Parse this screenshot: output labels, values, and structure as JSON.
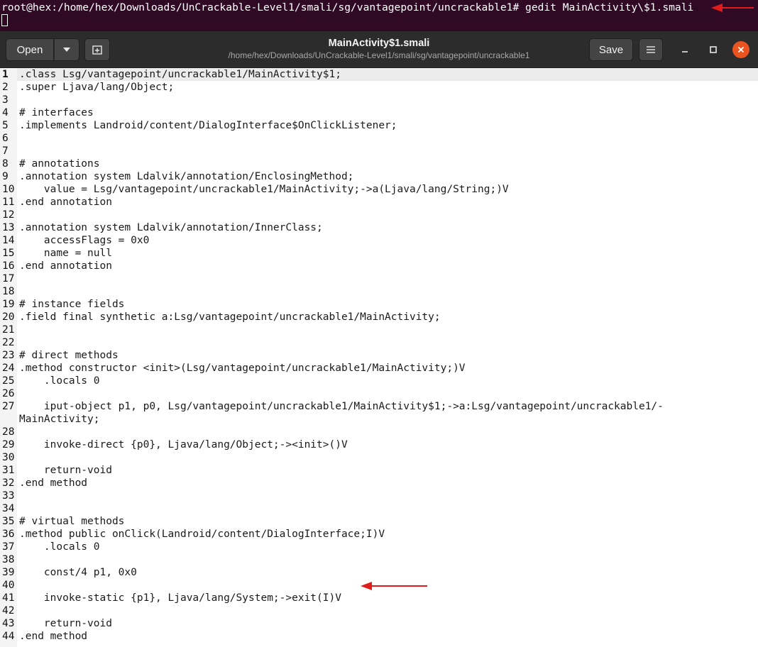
{
  "terminal": {
    "command": "root@hex:/home/hex/Downloads/UnCrackable-Level1/smali/sg/vantagepoint/uncrackable1# gedit MainActivity\\$1.smali"
  },
  "headerbar": {
    "open_label": "Open",
    "save_label": "Save",
    "title": "MainActivity$1.smali",
    "subtitle": "/home/hex/Downloads/UnCrackable-Level1/smali/sg/vantagepoint/uncrackable1"
  },
  "icons": {
    "open_menu": "chevron-down-icon",
    "new_tab": "new-tab-icon",
    "menu": "hamburger-menu-icon",
    "minimize": "minimize-icon",
    "maximize": "maximize-icon",
    "close": "close-icon",
    "annotation_arrow_color": "#e01b1b"
  },
  "editor": {
    "lines": [
      {
        "n": "1",
        "text": ".class Lsg/vantagepoint/uncrackable1/MainActivity$1;"
      },
      {
        "n": "2",
        "text": ".super Ljava/lang/Object;"
      },
      {
        "n": "3",
        "text": ""
      },
      {
        "n": "4",
        "text": "# interfaces"
      },
      {
        "n": "5",
        "text": ".implements Landroid/content/DialogInterface$OnClickListener;"
      },
      {
        "n": "6",
        "text": ""
      },
      {
        "n": "7",
        "text": ""
      },
      {
        "n": "8",
        "text": "# annotations"
      },
      {
        "n": "9",
        "text": ".annotation system Ldalvik/annotation/EnclosingMethod;"
      },
      {
        "n": "10",
        "text": "    value = Lsg/vantagepoint/uncrackable1/MainActivity;->a(Ljava/lang/String;)V"
      },
      {
        "n": "11",
        "text": ".end annotation"
      },
      {
        "n": "12",
        "text": ""
      },
      {
        "n": "13",
        "text": ".annotation system Ldalvik/annotation/InnerClass;"
      },
      {
        "n": "14",
        "text": "    accessFlags = 0x0"
      },
      {
        "n": "15",
        "text": "    name = null"
      },
      {
        "n": "16",
        "text": ".end annotation"
      },
      {
        "n": "17",
        "text": ""
      },
      {
        "n": "18",
        "text": ""
      },
      {
        "n": "19",
        "text": "# instance fields"
      },
      {
        "n": "20",
        "text": ".field final synthetic a:Lsg/vantagepoint/uncrackable1/MainActivity;"
      },
      {
        "n": "21",
        "text": ""
      },
      {
        "n": "22",
        "text": ""
      },
      {
        "n": "23",
        "text": "# direct methods"
      },
      {
        "n": "24",
        "text": ".method constructor <init>(Lsg/vantagepoint/uncrackable1/MainActivity;)V"
      },
      {
        "n": "25",
        "text": "    .locals 0"
      },
      {
        "n": "26",
        "text": ""
      },
      {
        "n": "27",
        "text": "    iput-object p1, p0, Lsg/vantagepoint/uncrackable1/MainActivity$1;->a:Lsg/vantagepoint/uncrackable1/-"
      },
      {
        "n": "",
        "text": "MainActivity;"
      },
      {
        "n": "28",
        "text": ""
      },
      {
        "n": "29",
        "text": "    invoke-direct {p0}, Ljava/lang/Object;-><init>()V"
      },
      {
        "n": "30",
        "text": ""
      },
      {
        "n": "31",
        "text": "    return-void"
      },
      {
        "n": "32",
        "text": ".end method"
      },
      {
        "n": "33",
        "text": ""
      },
      {
        "n": "34",
        "text": ""
      },
      {
        "n": "35",
        "text": "# virtual methods"
      },
      {
        "n": "36",
        "text": ".method public onClick(Landroid/content/DialogInterface;I)V"
      },
      {
        "n": "37",
        "text": "    .locals 0"
      },
      {
        "n": "38",
        "text": ""
      },
      {
        "n": "39",
        "text": "    const/4 p1, 0x0"
      },
      {
        "n": "40",
        "text": ""
      },
      {
        "n": "41",
        "text": "    invoke-static {p1}, Ljava/lang/System;->exit(I)V"
      },
      {
        "n": "42",
        "text": ""
      },
      {
        "n": "43",
        "text": "    return-void"
      },
      {
        "n": "44",
        "text": ".end method"
      }
    ]
  }
}
